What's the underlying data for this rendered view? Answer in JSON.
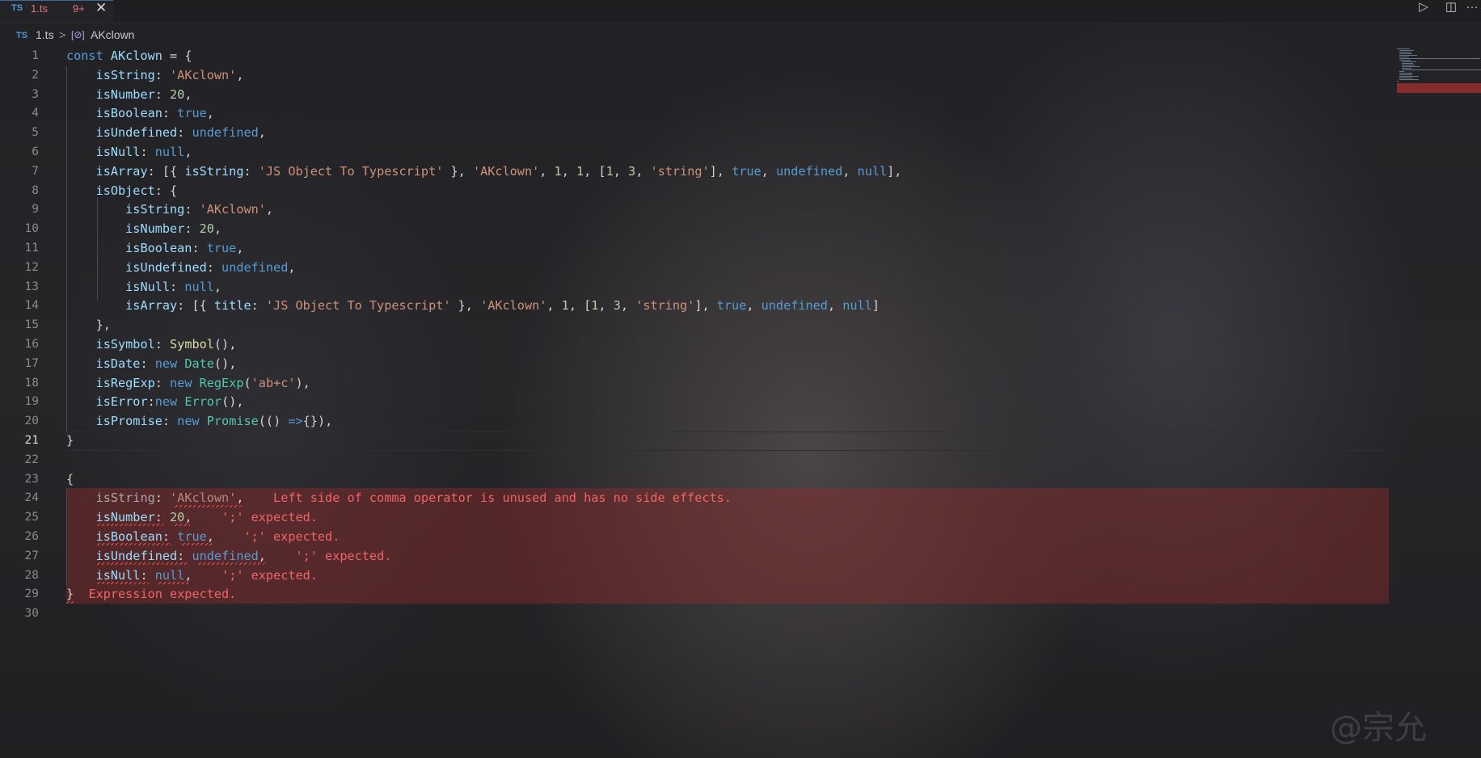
{
  "tab": {
    "ts_badge": "TS",
    "file_name": "1.ts",
    "problem_count": "9+",
    "close_label": "✕"
  },
  "toolbar": {
    "run_icon": "▷",
    "split_icon": "◫",
    "more_icon": "···"
  },
  "breadcrumb": {
    "ts_badge": "TS",
    "file": "1.ts",
    "separator": ">",
    "symbol_icon": "[⊘]",
    "symbol": "AKclown"
  },
  "editor": {
    "active_line": 21,
    "line_numbers": [
      "1",
      "2",
      "3",
      "4",
      "5",
      "6",
      "7",
      "8",
      "9",
      "10",
      "11",
      "12",
      "13",
      "14",
      "15",
      "16",
      "17",
      "18",
      "19",
      "20",
      "21",
      "22",
      "23",
      "24",
      "25",
      "26",
      "27",
      "28",
      "29",
      "30"
    ],
    "diagnostics": [
      {
        "line": 24,
        "message": "Left side of comma operator is unused and has no side effects."
      },
      {
        "line": 25,
        "message": "';' expected."
      },
      {
        "line": 26,
        "message": "';' expected."
      },
      {
        "line": 27,
        "message": "';' expected."
      },
      {
        "line": 28,
        "message": "';' expected."
      },
      {
        "line": 29,
        "message": "Expression expected."
      }
    ]
  },
  "watermark": "@宗允"
}
